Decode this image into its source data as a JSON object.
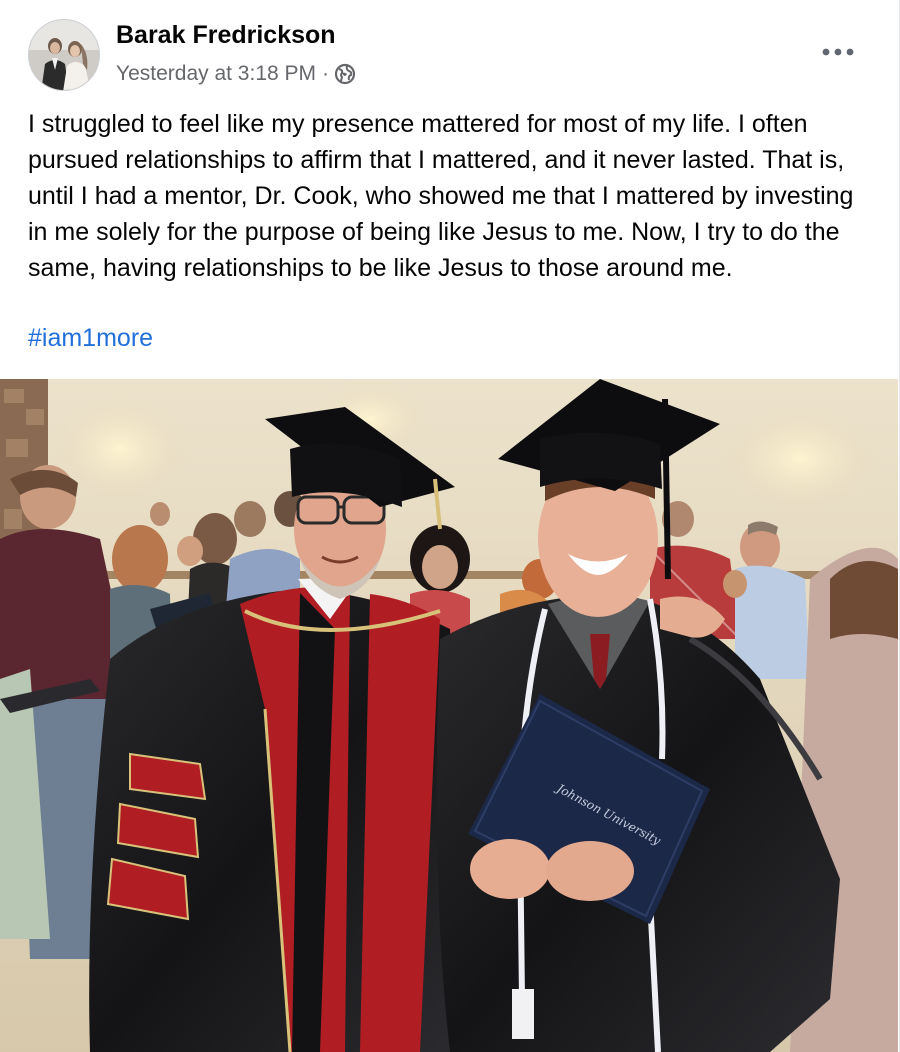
{
  "post": {
    "author_name": "Barak Fredrickson",
    "timestamp": "Yesterday at 3:18 PM",
    "separator": "·",
    "audience_icon": "globe-icon",
    "more_icon": "more-options-icon",
    "text": "I struggled to feel like my presence mattered for most of my life. I often pursued relationships to affirm that I mattered, and it never lasted. That is, until I had a mentor, Dr. Cook, who showed me that I mattered by investing in me solely for the purpose of being like Jesus to me. Now, I try to do the same, having relationships to be like Jesus to those around me.",
    "hashtag": "#iam1more",
    "photo": {
      "diploma_text": "Johnson University"
    }
  },
  "colors": {
    "name": "#050505",
    "meta": "#65676b",
    "link": "#216fdb",
    "background": "#ffffff"
  }
}
